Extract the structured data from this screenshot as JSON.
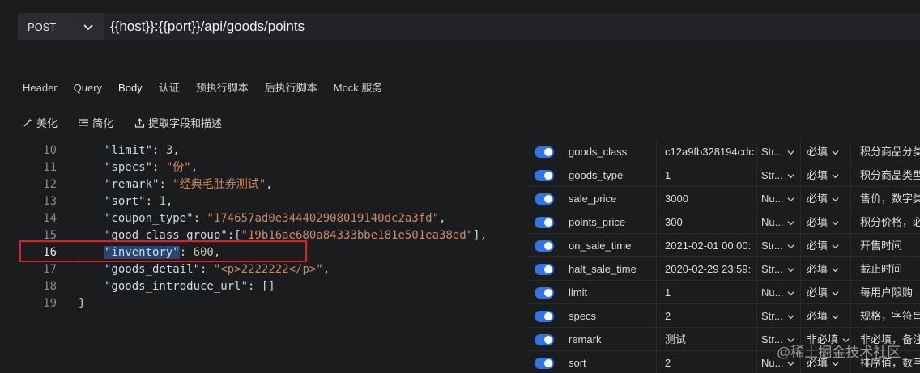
{
  "request": {
    "method": "POST",
    "url": "{{host}}:{{port}}/api/goods/points"
  },
  "tabs": [
    "Header",
    "Query",
    "Body",
    "认证",
    "预执行脚本",
    "后执行脚本",
    "Mock 服务"
  ],
  "tools": {
    "beautify": "美化",
    "simplify": "简化",
    "extract": "提取字段和描述"
  },
  "editor": {
    "lines": [
      {
        "no": "10",
        "key": "\"limit\"",
        "sep": ": ",
        "val": "3",
        "end": ",",
        "vtype": "n"
      },
      {
        "no": "11",
        "key": "\"specs\"",
        "sep": ": ",
        "val": "\"份\"",
        "end": ",",
        "vtype": "s"
      },
      {
        "no": "12",
        "key": "\"remark\"",
        "sep": ": ",
        "val": "\"经典毛肚券测试\"",
        "end": ",",
        "vtype": "s"
      },
      {
        "no": "13",
        "key": "\"sort\"",
        "sep": ": ",
        "val": "1",
        "end": ",",
        "vtype": "n"
      },
      {
        "no": "14",
        "key": "\"coupon_type\"",
        "sep": ": ",
        "val": "\"174657ad0e344402908019140dc2a3fd\"",
        "end": ",",
        "vtype": "s"
      },
      {
        "no": "15",
        "key": "\"good_class_group\"",
        "sep": ":[",
        "val": "\"19b16ae680a84333bbe181e501ea38ed\"",
        "end": "],",
        "vtype": "s"
      },
      {
        "no": "16",
        "key": "\"inventory\"",
        "sep": ": ",
        "val": "600",
        "end": ",",
        "vtype": "n"
      },
      {
        "no": "17",
        "key": "\"goods_detail\"",
        "sep": ": ",
        "val": "\"<p>2222222</p>\"",
        "end": ",",
        "vtype": "s"
      },
      {
        "no": "18",
        "key": "\"goods_introduce_url\"",
        "sep": ": ",
        "val": "[]",
        "end": "",
        "vtype": "p"
      },
      {
        "no": "19",
        "key": "}",
        "sep": "",
        "val": "",
        "end": "",
        "vtype": "p"
      }
    ]
  },
  "params": [
    {
      "name": "goods_class",
      "value": "c12a9fb328194cdc",
      "type": "Str...",
      "req": "必填",
      "desc": "积分商品分类id"
    },
    {
      "name": "goods_type",
      "value": "1",
      "type": "Str...",
      "req": "必填",
      "desc": "积分商品类型，1"
    },
    {
      "name": "sale_price",
      "value": "3000",
      "type": "Nu...",
      "req": "必填",
      "desc": "售价，数字类型，"
    },
    {
      "name": "points_price",
      "value": "300",
      "type": "Nu...",
      "req": "必填",
      "desc": "积分价格，必须为"
    },
    {
      "name": "on_sale_time",
      "value": "2021-02-01 00:00:",
      "type": "Str...",
      "req": "必填",
      "desc": "开售时间"
    },
    {
      "name": "halt_sale_time",
      "value": "2020-02-29 23:59:",
      "type": "Str...",
      "req": "必填",
      "desc": "截止时间"
    },
    {
      "name": "limit",
      "value": "1",
      "type": "Nu...",
      "req": "必填",
      "desc": "每用户限购"
    },
    {
      "name": "specs",
      "value": "2",
      "type": "Str...",
      "req": "必填",
      "desc": "规格，字符串类型"
    },
    {
      "name": "remark",
      "value": "测试",
      "type": "Str...",
      "req": "非必填",
      "desc": "非必填，备注信息"
    },
    {
      "name": "sort",
      "value": "2",
      "type": "Nu...",
      "req": "必填",
      "desc": "排序值，数字越大"
    }
  ],
  "watermark": "@稀土掘金技术社区",
  "colors": {
    "toggle_on": "#2f75e6",
    "highlight_box": "#e01e25",
    "selection": "#284770"
  }
}
